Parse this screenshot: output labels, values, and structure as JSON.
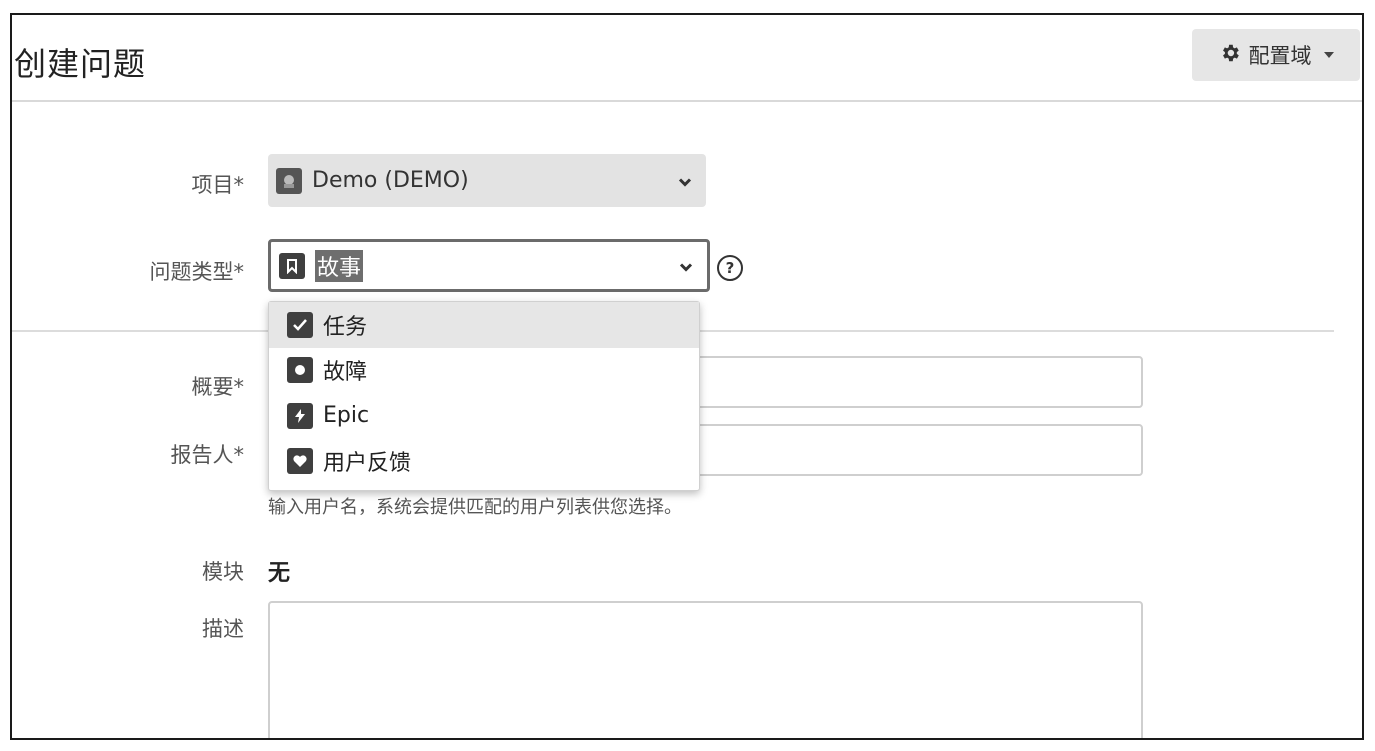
{
  "header": {
    "title": "创建问题",
    "config_label": "配置域"
  },
  "form": {
    "project": {
      "label": "项目*",
      "value": "Demo (DEMO)"
    },
    "issue_type": {
      "label": "问题类型*",
      "value": "故事"
    },
    "summary": {
      "label": "概要*"
    },
    "reporter": {
      "label": "报告人*",
      "hint": "输入用户名，系统会提供匹配的用户列表供您选择。"
    },
    "component": {
      "label": "模块",
      "value": "无"
    },
    "description": {
      "label": "描述"
    }
  },
  "dropdown": {
    "items": [
      {
        "label": "任务",
        "icon": "check-icon"
      },
      {
        "label": "故障",
        "icon": "bug-icon"
      },
      {
        "label": "Epic",
        "icon": "lightning-icon"
      },
      {
        "label": "用户反馈",
        "icon": "heart-icon"
      }
    ]
  }
}
